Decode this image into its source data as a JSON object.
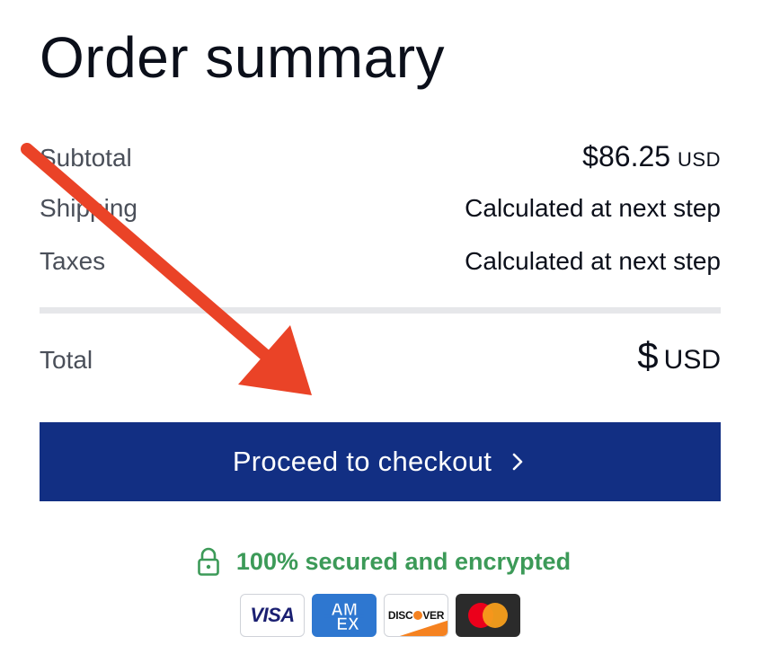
{
  "page": {
    "title": "Order summary"
  },
  "summary": {
    "subtotal": {
      "label": "Subtotal",
      "amount": "$86.25",
      "currency": "USD"
    },
    "shipping": {
      "label": "Shipping",
      "value": "Calculated at next step"
    },
    "taxes": {
      "label": "Taxes",
      "value": "Calculated at next step"
    },
    "total": {
      "label": "Total",
      "amount": "$",
      "currency": "USD"
    }
  },
  "checkout": {
    "button_label": "Proceed to checkout",
    "icon": "chevron-right-icon"
  },
  "security": {
    "icon": "lock-icon",
    "text": "100% secured and encrypted"
  },
  "payment_methods": [
    {
      "name": "VISA",
      "icon": "visa-card-icon"
    },
    {
      "name": "AMEX",
      "icon": "amex-card-icon"
    },
    {
      "name": "DISCOVER",
      "icon": "discover-card-icon"
    },
    {
      "name": "Mastercard",
      "icon": "mastercard-card-icon"
    }
  ],
  "colors": {
    "button_bg": "#122f83",
    "secure_green": "#3c9a58",
    "annotation_arrow": "#ea4327"
  }
}
